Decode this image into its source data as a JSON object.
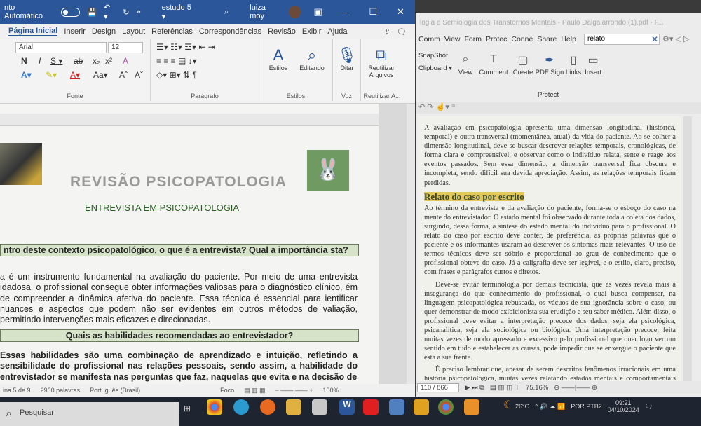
{
  "word": {
    "autosave": "nto Automático",
    "doc_name": "estudo 5 ▾",
    "user": "luiza moy",
    "tabs": [
      "Página Inicial",
      "Inserir",
      "Design",
      "Layout",
      "Referências",
      "Correspondências",
      "Revisão",
      "Exibir",
      "Ajuda"
    ],
    "font": "Arial",
    "size": "12",
    "groups": {
      "fonte": "Fonte",
      "paragrafo": "Parágrafo",
      "estilos": "Estilos",
      "voz": "Voz",
      "reutilizar": "Reutilizar A..."
    },
    "buttons": {
      "estilos": "Estilos",
      "editando": "Editando",
      "ditar": "Ditar",
      "reutilizar": "Reutilizar Arquivos"
    },
    "doc": {
      "title": "REVISÃO PSICOPATOLOGIA",
      "subtitle": "ENTREVISTA EM PSICOPATOLOGIA",
      "q1": "ntro deste contexto psicopatológico, o que é a entrevista? Qual a importância sta?",
      "p1": "a é um instrumento fundamental na avaliação do paciente. Por meio de uma entrevista idadosa, o profissional consegue obter informações valiosas para o diagnóstico clínico, ém de compreender a dinâmica afetiva do paciente. Essa técnica é essencial para ientificar nuances e aspectos que podem não ser evidentes em outros métodos de valiação, permitindo intervenções mais eficazes e direcionadas.",
      "q2": "Quais as habilidades recomendadas ao entrevistador?",
      "p2": "Essas habilidades são uma combinação de aprendizado e intuição, refletindo a sensibilidade do profissional nas relações pessoais, sendo assim, a habilidade do entrevistador se manifesta nas perguntas que faz, naquelas que evita e na decisão de"
    },
    "status": {
      "page": "ina 5 de 9",
      "words": "2960 palavras",
      "lang": "Português (Brasil)",
      "focus": "Foco",
      "zoom": "100%"
    }
  },
  "pdf": {
    "title": "logia e Semiologia dos Transtornos Mentais - Paulo Dalgalarrondo (1).pdf - F...",
    "menu": [
      "Comm",
      "View",
      "Form",
      "Protec",
      "Conne",
      "Share",
      "Help"
    ],
    "search": "relato",
    "ribbon": {
      "snapshot": "SnapShot",
      "clipboard": "Clipboard ▾",
      "view": "View",
      "comment": "Comment",
      "create": "Create",
      "pdfsign": "PDF Sign",
      "protect": "Protect",
      "links": "Links",
      "insert": "Insert"
    },
    "p1": "A avaliação em psicopatologia apresenta uma dimensão longitudinal (histórica, temporal) e outra transversal (momentânea, atual) da vida do paciente. Ao se colher a dimensão longitudinal, deve-se buscar descrever relações temporais, cronológicas, de forma clara e compreensível, e observar como o indivíduo relata, sente e reage aos eventos passados. Sem essa dimensão, a dimensão transversal fica obscura e incompleta, sendo difícil sua devida apreciação. Assim, as relações temporais ficam perdidas.",
    "heading": "Relato do caso por escrito",
    "p2": "Ao término da entrevista e da avaliação do paciente, forma-se o esboço do caso na mente do entrevistador. O estado mental foi observado durante toda a coleta dos dados, surgindo, dessa forma, a síntese do estado mental do indivíduo para o profissional. O relato do caso por escrito deve conter, de preferência, as próprias palavras que o paciente e os informantes usaram ao descrever os sintomas mais relevantes. O uso de termos técnicos deve ser sóbrio e proporcional ao grau de conhecimento que o profissional obteve do caso. Já a caligrafia deve ser legível, e o estilo, claro, preciso, com frases e parágrafos curtos e diretos.",
    "p3": "Deve-se evitar terminologia por demais tecnicista, que às vezes revela mais a insegurança do que conhecimento do profissional, o qual busca compensar, na linguagem psicopatológica rebuscada, os vácuos de sua ignorância sobre o caso, ou quer demonstrar de modo exibicionista sua erudição e seu saber médico. Além disso, o profissional deve evitar a interpretação precoce dos dados, seja ela psicológica, psicanalítica, seja ela sociológica ou biológica. Uma interpretação precoce, feita muitas vezes de modo apressado e excessivo pelo profissional que quer logo ver um sentido em tudo e estabelecer as causas, pode impedir que se enxergue o paciente que está a sua frente.",
    "p4": "É preciso lembrar que, apesar de serem descritos fenômenos irracionais em uma história psicopatológica, muitas vezes relatando estados mentais e comportamentais marcadamente desorganizados e caóticos, o relato em si deve",
    "page": "110 / 866",
    "zoom": "75.16%"
  },
  "taskbar": {
    "search": "Pesquisar",
    "temp": "26°C",
    "lang": "POR PTB2",
    "time": "09:21",
    "date": "04/10/2024"
  }
}
